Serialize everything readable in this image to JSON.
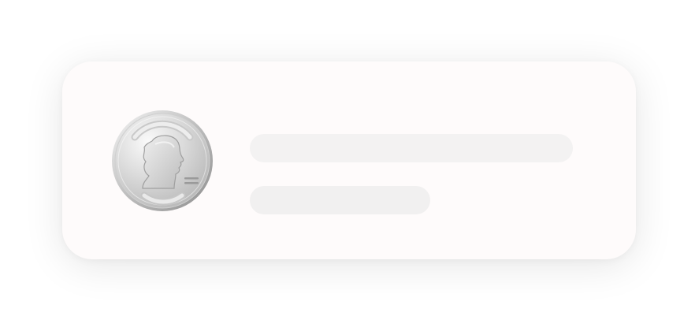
{
  "card": {
    "avatar": {
      "icon": "coin-icon",
      "description_state": "loading"
    },
    "skeleton": {
      "state": "loading",
      "lines": 2
    }
  },
  "colors": {
    "page_background": "#ffffff",
    "card_background": "#fefbfb",
    "skeleton_primary": "#f3f2f2",
    "skeleton_secondary": "#f1f0f0",
    "coin_silver_light": "#f2f2f2",
    "coin_silver_dark": "#a9a9a9"
  }
}
